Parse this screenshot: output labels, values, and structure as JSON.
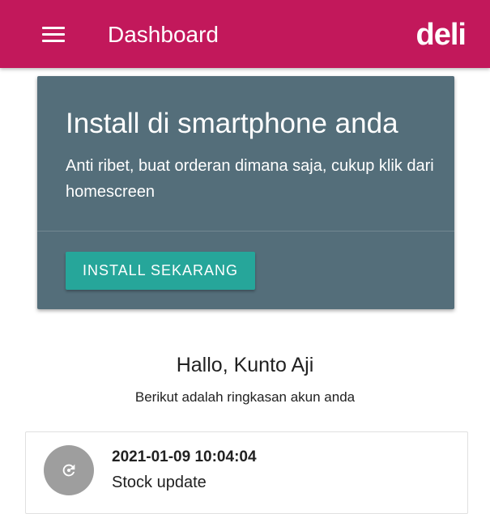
{
  "appbar": {
    "title": "Dashboard",
    "brand": "deli",
    "color": "#c2185b",
    "menu_icon": "hamburger-menu-icon"
  },
  "install_card": {
    "title": "Install di smartphone anda",
    "text": "Anti ribet, buat orderan dimana saja, cukup klik dari homescreen",
    "button_label": "INSTALL SEKARANG",
    "card_color": "#546e7a",
    "button_color": "#26a69a"
  },
  "greeting": {
    "hello": "Hallo, Kunto Aji",
    "summary": "Berikut adalah ringkasan akun anda"
  },
  "activity": {
    "items": [
      {
        "timestamp": "2021-01-09 10:04:04",
        "title": "Stock update",
        "icon": "refresh-icon"
      }
    ]
  }
}
